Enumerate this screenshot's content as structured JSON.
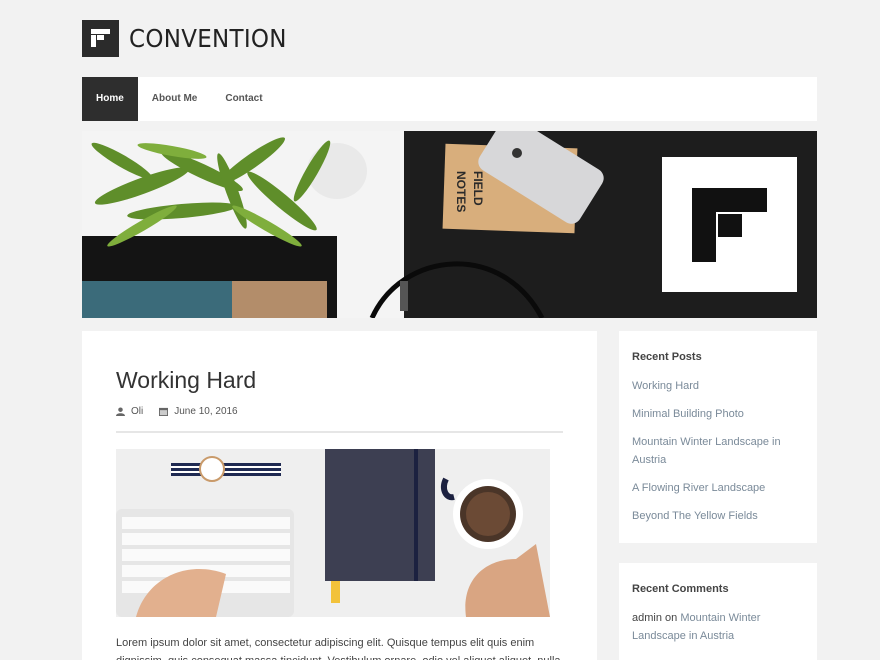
{
  "site": {
    "title": "CONVENTION"
  },
  "nav": {
    "items": [
      {
        "label": "Home",
        "active": true
      },
      {
        "label": "About Me",
        "active": false
      },
      {
        "label": "Contact",
        "active": false
      }
    ]
  },
  "hero": {
    "notebook_text_1": "FIELD",
    "notebook_text_2": "NOTES"
  },
  "post": {
    "title": "Working Hard",
    "author": "Oli",
    "date": "June 10, 2016",
    "excerpt_line1": "Lorem ipsum dolor sit amet, consectetur adipiscing elit. Quisque tempus elit quis enim",
    "excerpt_line2": "dignissim, quis consequat massa tincidunt. Vestibulum ornare, odio vel aliquet aliquet, nulla"
  },
  "sidebar": {
    "recent_posts": {
      "heading": "Recent Posts",
      "items": [
        "Working Hard",
        "Minimal Building Photo",
        "Mountain Winter Landscape in Austria",
        "A Flowing River Landscape",
        "Beyond The Yellow Fields"
      ]
    },
    "recent_comments": {
      "heading": "Recent Comments",
      "author": "admin",
      "on_word": "on",
      "post_link": "Mountain Winter Landscape in Austria"
    }
  },
  "colors": {
    "background": "#f2f2f2",
    "nav_active": "#2e2e2e",
    "link": "#7a8a99",
    "text": "#333333"
  }
}
